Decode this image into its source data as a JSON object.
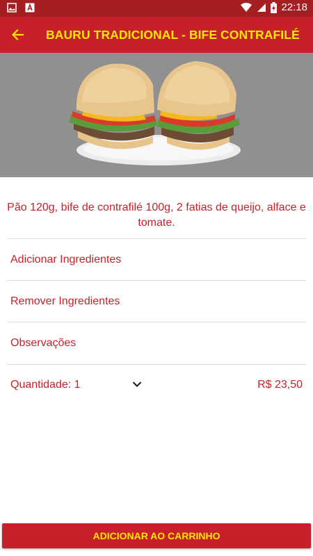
{
  "colors": {
    "primary": "#c8202a",
    "statusbar": "#a51e22",
    "accent_text": "#ffe600",
    "hero_bg": "#909090"
  },
  "status_bar": {
    "time": "22:18",
    "icons": [
      "image-icon",
      "app-a-icon",
      "wifi-icon",
      "signal-icon",
      "battery-charging-icon"
    ]
  },
  "header": {
    "title": "BAURU TRADICIONAL - BIFE CONTRAFILÉ",
    "back_icon": "arrow-left-icon"
  },
  "product": {
    "description": "Pão 120g, bife de contrafilé 100g, 2 fatias de queijo, alface e tomate."
  },
  "options": [
    {
      "label": "Adicionar Ingredientes"
    },
    {
      "label": "Remover Ingredientes"
    },
    {
      "label": "Observações"
    }
  ],
  "quantity": {
    "label": "Quantidade: 1",
    "chevron_icon": "chevron-down-icon"
  },
  "price": "R$ 23,50",
  "cart_button": "ADICIONAR AO CARRINHO"
}
